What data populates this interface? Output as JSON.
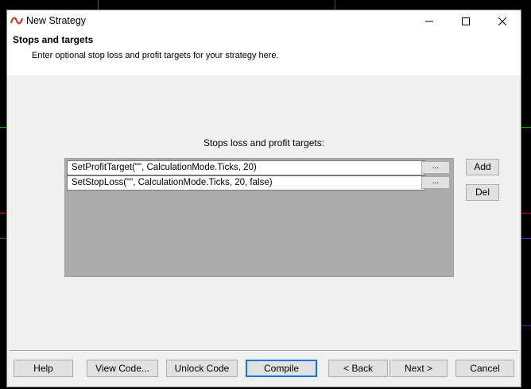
{
  "window": {
    "title": "New Strategy",
    "controls": {
      "minimize": "minimize-icon",
      "maximize": "maximize-icon",
      "close": "close-icon"
    }
  },
  "header": {
    "title": "Stops and targets",
    "description": "Enter optional stop loss and profit targets for your strategy here."
  },
  "main": {
    "section_label": "Stops loss and profit targets:",
    "items": [
      {
        "text": "SetProfitTarget(\"\", CalculationMode.Ticks, 20)",
        "button": "..."
      },
      {
        "text": "SetStopLoss(\"\", CalculationMode.Ticks, 20, false)",
        "button": "..."
      }
    ],
    "add_label": "Add",
    "del_label": "Del"
  },
  "footer": {
    "help": "Help",
    "view_code": "View Code...",
    "unlock_code": "Unlock Code",
    "compile": "Compile",
    "back": "< Back",
    "next": "Next >",
    "cancel": "Cancel"
  },
  "colors": {
    "accent": "#0078d7",
    "list_background": "#ababab",
    "dialog": "#f0f0f0"
  }
}
